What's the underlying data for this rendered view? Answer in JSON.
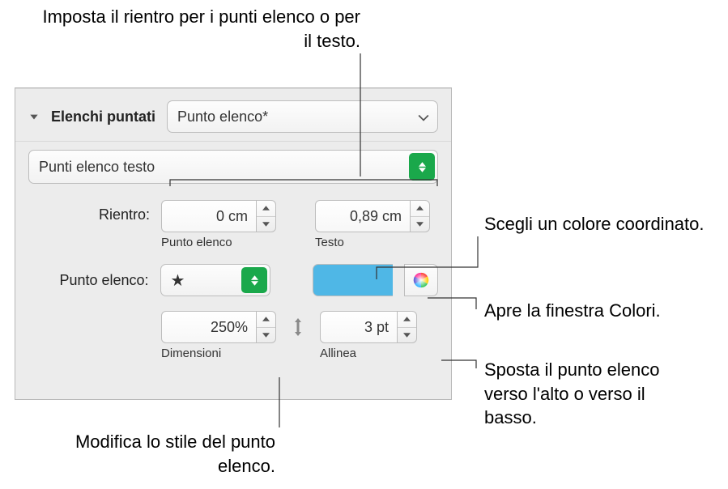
{
  "callouts": {
    "top": "Imposta il rientro per i punti elenco o per il testo.",
    "color_swatch": "Scegli un colore coordinato.",
    "color_wheel": "Apre la finestra Colori.",
    "align": "Sposta il punto elenco verso l'alto o verso il basso.",
    "size": "Modifica lo stile del punto elenco."
  },
  "panel": {
    "section_title": "Elenchi puntati",
    "style_popup": "Punto elenco*",
    "type_popup": "Punti elenco testo",
    "rientro": {
      "label": "Rientro:",
      "bullet_value": "0 cm",
      "bullet_caption": "Punto elenco",
      "text_value": "0,89 cm",
      "text_caption": "Testo"
    },
    "bullet": {
      "label": "Punto elenco:",
      "glyph": "★"
    },
    "size": {
      "value": "250%",
      "caption": "Dimensioni"
    },
    "align": {
      "value": "3 pt",
      "caption": "Allinea"
    }
  }
}
